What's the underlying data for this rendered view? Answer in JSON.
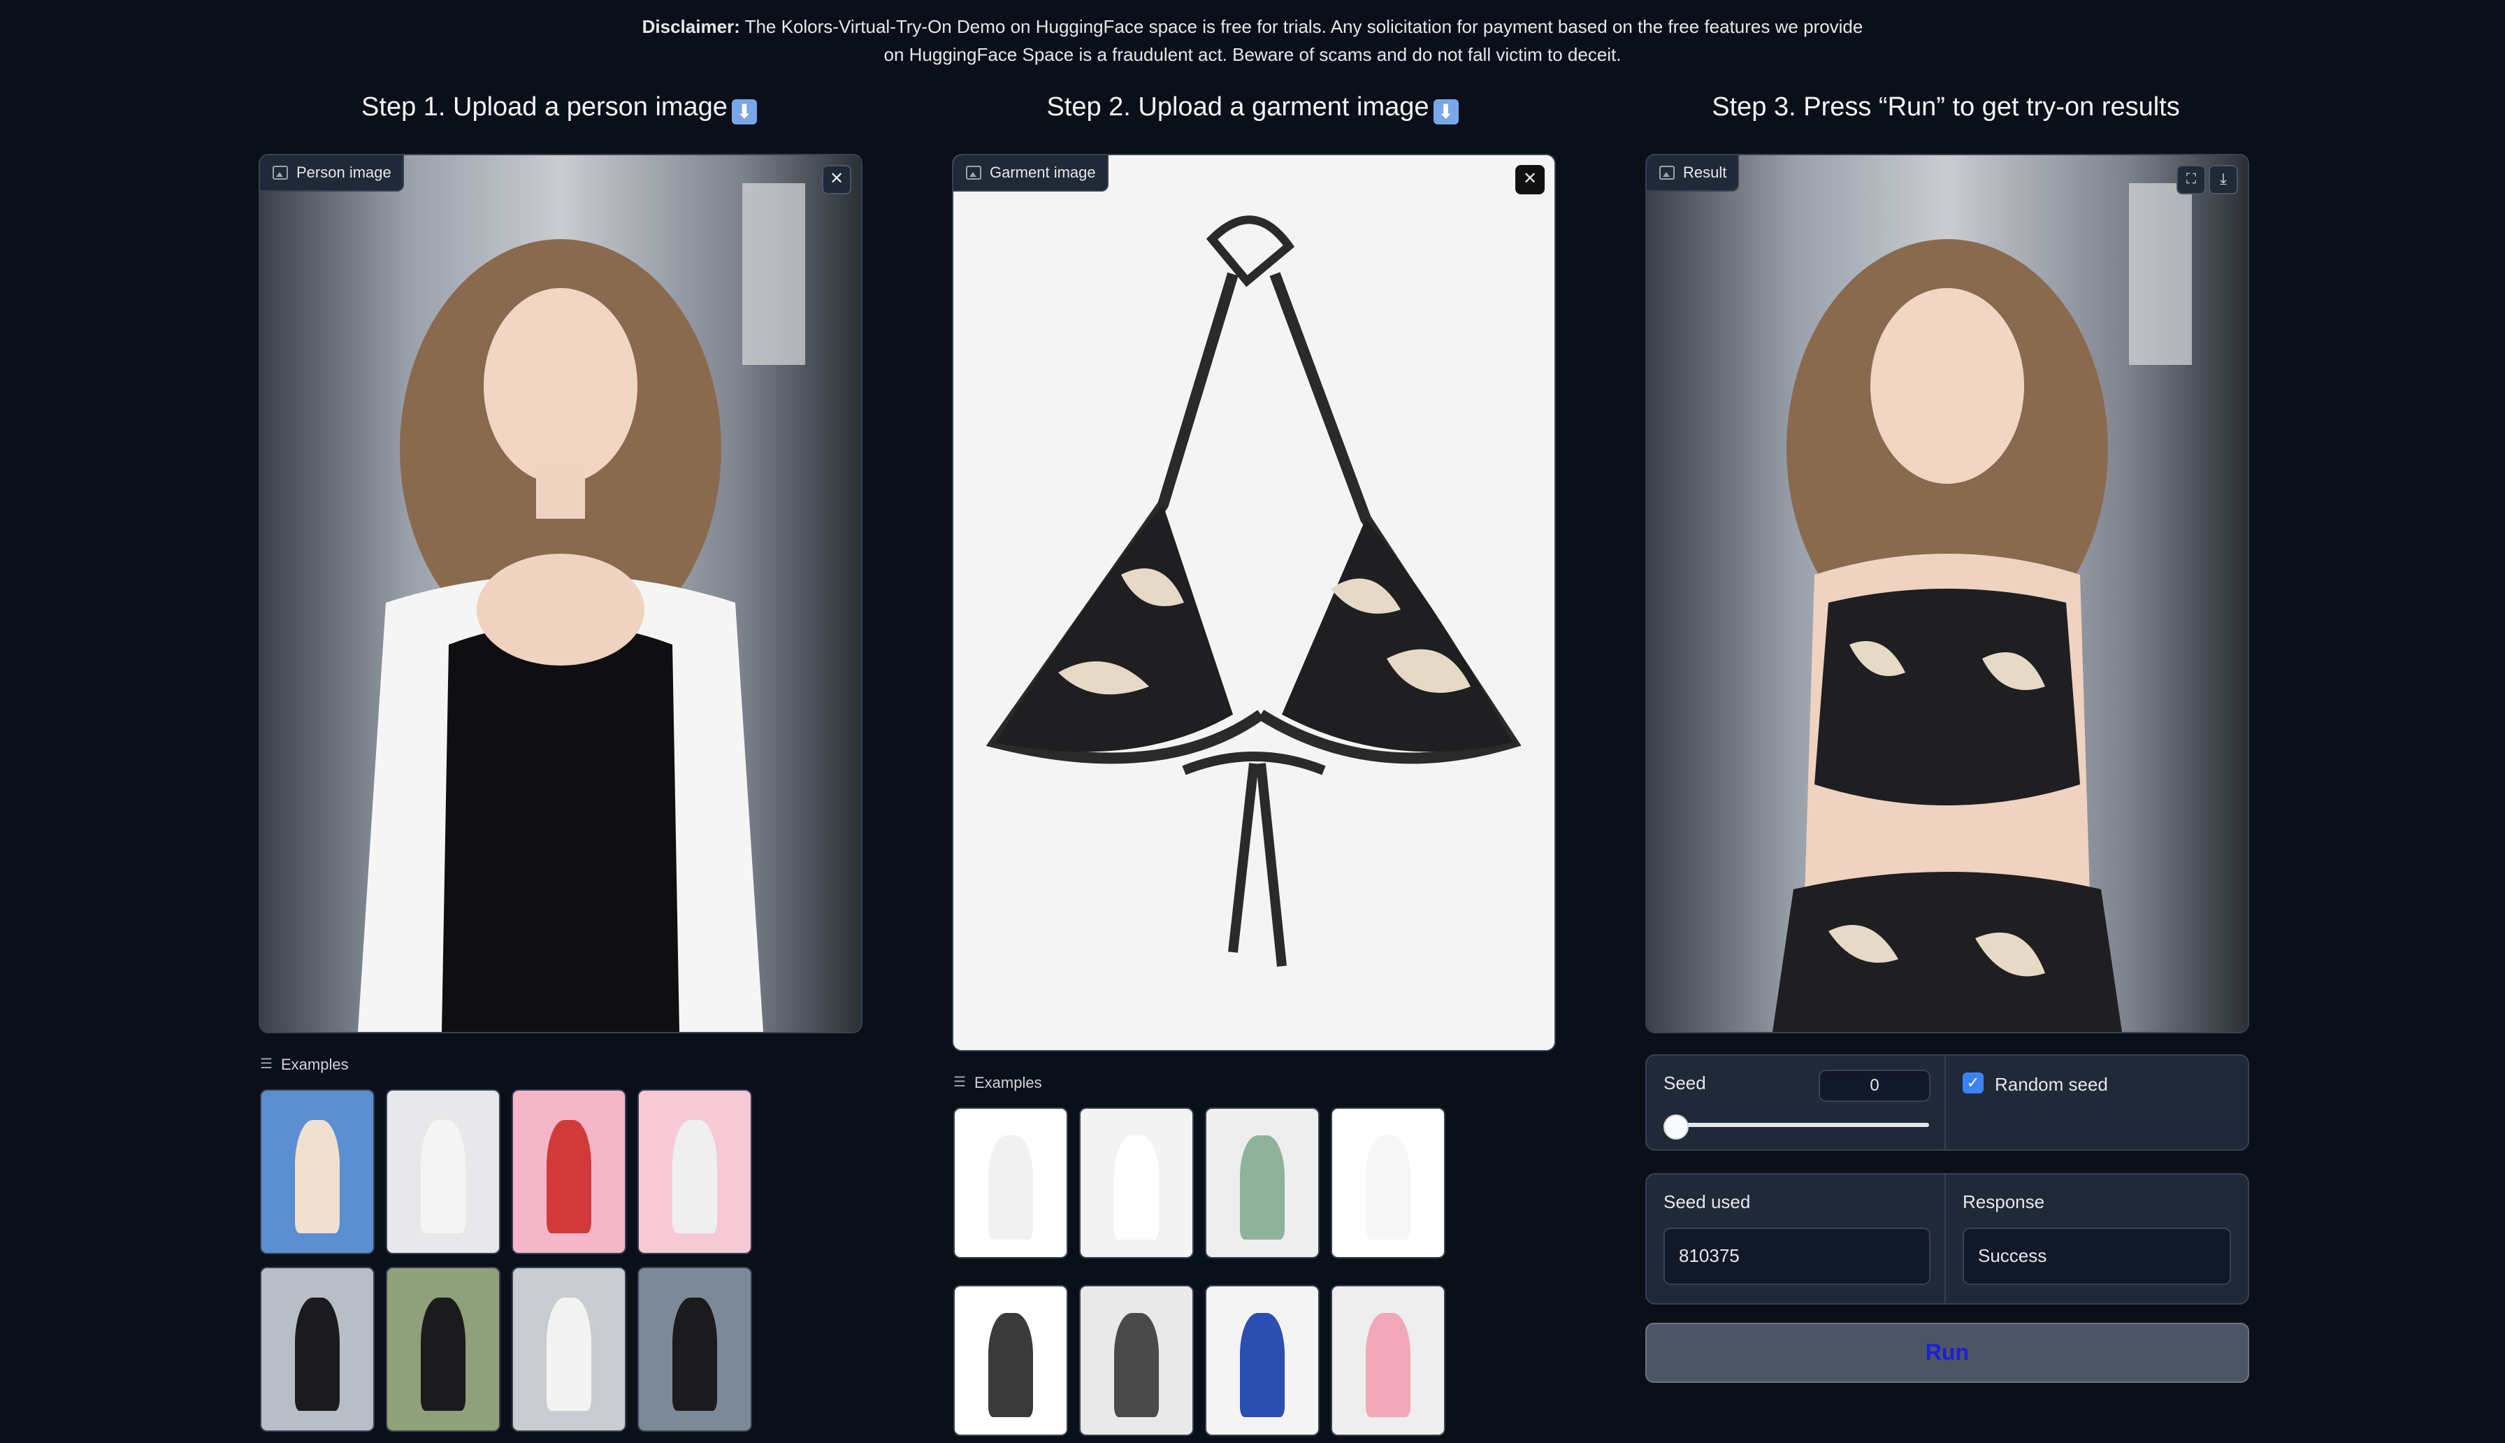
{
  "disclaimer": {
    "bold": "Disclaimer:",
    "line1": " The Kolors-Virtual-Try-On Demo on HuggingFace space is free for trials. Any solicitation for payment based on the free features we provide",
    "line2": "on HuggingFace Space is a fraudulent act. Beware of scams and do not fall victim to deceit."
  },
  "steps": {
    "step1": "Step 1. Upload a person image",
    "step2": "Step 2. Upload a garment image",
    "step3": "Step 3. Press “Run” to get try-on results",
    "emoji": "⬇"
  },
  "person_panel": {
    "label": "Person image",
    "close": "✕"
  },
  "garment_panel": {
    "label": "Garment image",
    "close": "✕"
  },
  "result_panel": {
    "label": "Result",
    "fullscreen": "⛶",
    "download": "⤓"
  },
  "examples_label": "Examples",
  "seed": {
    "label": "Seed",
    "value": "0",
    "slider_fraction": 0.0
  },
  "random_seed": {
    "label": "Random seed",
    "checked": true
  },
  "seed_used": {
    "label": "Seed used",
    "value": "810375"
  },
  "response": {
    "label": "Response",
    "value": "Success"
  },
  "run_button": "Run",
  "colors": {
    "background": "#0b0f19",
    "panel": "#1f2937",
    "accent": "#3b82f6",
    "run_text": "#1d1de0"
  }
}
